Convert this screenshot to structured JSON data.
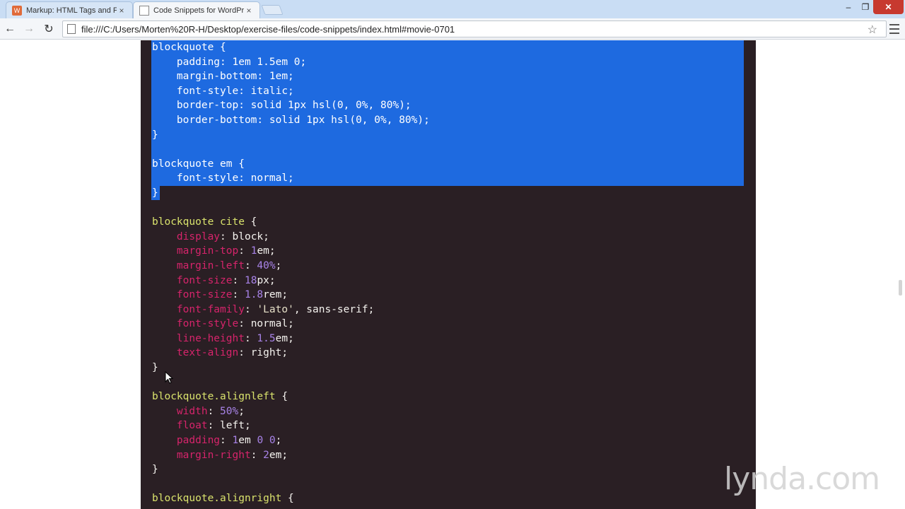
{
  "browser": {
    "tabs": [
      {
        "title": "Markup: HTML Tags and Formatting",
        "favicon": "wordpress-favicon",
        "active": false
      },
      {
        "title": "Code Snippets for WordPress",
        "favicon": "page-favicon",
        "active": true
      }
    ],
    "tab_close_glyph": "×",
    "window_controls": {
      "minimize": "–",
      "maximize": "❐",
      "close": "✕"
    },
    "nav": {
      "back": "←",
      "forward": "→",
      "reload": "↻"
    },
    "address": "file:///C:/Users/Morten%20R-H/Desktop/exercise-files/code-snippets/index.html#movie-0701",
    "bookmark_star": "☆"
  },
  "code": {
    "selected_lines": [
      "blockquote {",
      "    padding: 1em 1.5em 0;",
      "    margin-bottom: 1em;",
      "    font-style: italic;",
      "    border-top: solid 1px hsl(0, 0%, 80%);",
      "    border-bottom: solid 1px hsl(0, 0%, 80%);",
      "}",
      "",
      "blockquote em {",
      "    font-style: normal;",
      "}"
    ],
    "rules": [
      {
        "selector": "blockquote cite {",
        "decls": [
          {
            "prop": "display",
            "val": [
              {
                "t": "block",
                "k": "kw"
              }
            ]
          },
          {
            "prop": "margin-top",
            "val": [
              {
                "t": "1",
                "k": "n"
              },
              {
                "t": "em",
                "k": "kw"
              }
            ]
          },
          {
            "prop": "margin-left",
            "val": [
              {
                "t": "40%",
                "k": "n"
              }
            ]
          },
          {
            "prop": "font-size",
            "val": [
              {
                "t": "18",
                "k": "n"
              },
              {
                "t": "px",
                "k": "kw"
              }
            ]
          },
          {
            "prop": "font-size",
            "val": [
              {
                "t": "1.8",
                "k": "n"
              },
              {
                "t": "rem",
                "k": "kw"
              }
            ]
          },
          {
            "prop": "font-family",
            "val": [
              {
                "t": "'Lato'",
                "k": "str"
              },
              {
                "t": ", sans-serif",
                "k": "kw"
              }
            ]
          },
          {
            "prop": "font-style",
            "val": [
              {
                "t": "normal",
                "k": "kw"
              }
            ]
          },
          {
            "prop": "line-height",
            "val": [
              {
                "t": "1.5",
                "k": "n"
              },
              {
                "t": "em",
                "k": "kw"
              }
            ]
          },
          {
            "prop": "text-align",
            "val": [
              {
                "t": "right",
                "k": "kw"
              }
            ]
          }
        ]
      },
      {
        "selector": "blockquote.alignleft {",
        "decls": [
          {
            "prop": "width",
            "val": [
              {
                "t": "50%",
                "k": "n"
              }
            ]
          },
          {
            "prop": "float",
            "val": [
              {
                "t": "left",
                "k": "kw"
              }
            ]
          },
          {
            "prop": "padding",
            "val": [
              {
                "t": "1",
                "k": "n"
              },
              {
                "t": "em ",
                "k": "kw"
              },
              {
                "t": "0 0",
                "k": "n"
              }
            ]
          },
          {
            "prop": "margin-right",
            "val": [
              {
                "t": "2",
                "k": "n"
              },
              {
                "t": "em",
                "k": "kw"
              }
            ]
          }
        ]
      },
      {
        "selector": "blockquote.alignright {",
        "decls": []
      }
    ]
  },
  "watermark": "lynda.com"
}
